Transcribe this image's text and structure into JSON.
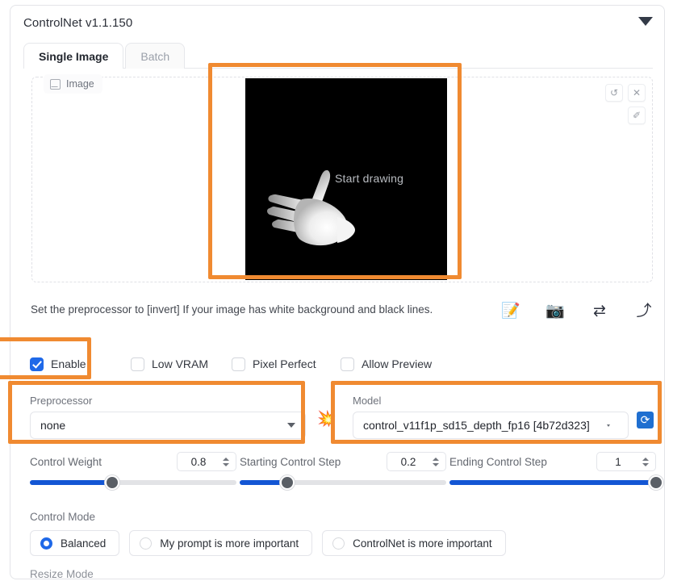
{
  "panel": {
    "title": "ControlNet v1.1.150",
    "collapse_icon": "chevron-down-icon"
  },
  "tabs": [
    {
      "label": "Single Image",
      "active": true
    },
    {
      "label": "Batch",
      "active": false
    }
  ],
  "image_area": {
    "tab_label": "Image",
    "canvas_hint": "Start drawing",
    "canvas_background": "#000000",
    "tools": [
      {
        "name": "undo-icon",
        "glyph": "↺"
      },
      {
        "name": "close-icon",
        "glyph": "✕"
      },
      {
        "name": "brush-icon",
        "glyph": "✐"
      }
    ]
  },
  "hint": {
    "text": "Set the preprocessor to [invert] If your image has white background and black lines.",
    "icons": [
      {
        "name": "new-canvas-icon",
        "glyph": "📝"
      },
      {
        "name": "webcam-icon",
        "glyph": "📷"
      },
      {
        "name": "mirror-webcam-icon",
        "glyph": "⇄"
      },
      {
        "name": "send-dimensions-icon",
        "glyph": "⤴"
      }
    ]
  },
  "checkboxes": [
    {
      "label": "Enable",
      "checked": true
    },
    {
      "label": "Low VRAM",
      "checked": false
    },
    {
      "label": "Pixel Perfect",
      "checked": false
    },
    {
      "label": "Allow Preview",
      "checked": false
    }
  ],
  "preprocessor": {
    "label": "Preprocessor",
    "value": "none",
    "caret_icon": "chevron-down-icon"
  },
  "model": {
    "label": "Model",
    "value": "control_v11f1p_sd15_depth_fp16 [4b72d323]",
    "caret_icon": "chevron-down-icon"
  },
  "boom_button": {
    "name": "explosion-icon",
    "glyph": "💥"
  },
  "refresh_button": {
    "name": "refresh-icon",
    "glyph": "⟳"
  },
  "sliders": [
    {
      "label": "Control Weight",
      "value": "0.8",
      "percent": 40
    },
    {
      "label": "Starting Control Step",
      "value": "0.2",
      "percent": 23
    },
    {
      "label": "Ending Control Step",
      "value": "1",
      "percent": 100
    }
  ],
  "control_mode": {
    "label": "Control Mode",
    "options": [
      {
        "label": "Balanced",
        "selected": true
      },
      {
        "label": "My prompt is more important",
        "selected": false
      },
      {
        "label": "ControlNet is more important",
        "selected": false
      }
    ]
  },
  "resize_mode": {
    "label": "Resize Mode"
  },
  "colors": {
    "highlight": "#f08a31",
    "accent_blue": "#1f69e8",
    "slider_fill": "#1356d4",
    "refresh_blue": "#1f6fd0"
  }
}
